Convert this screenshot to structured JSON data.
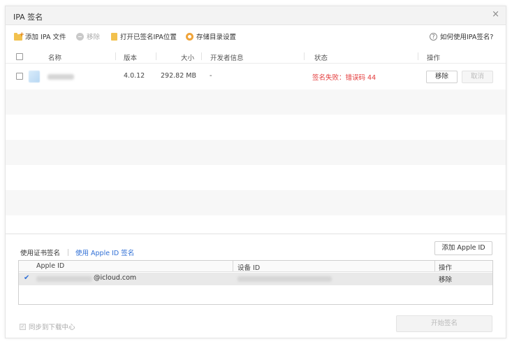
{
  "window": {
    "title": "IPA 签名",
    "close_glyph": "×"
  },
  "toolbar": {
    "add_ipa": "添加 IPA 文件",
    "remove": "移除",
    "open_signed": "打开已签名IPA位置",
    "storage_settings": "存储目录设置",
    "help": "如何使用IPA签名?",
    "help_glyph": "?"
  },
  "table": {
    "headers": {
      "name": "名称",
      "version": "版本",
      "size": "大小",
      "developer": "开发者信息",
      "status": "状态",
      "actions": "操作"
    },
    "rows": [
      {
        "version": "4.0.12",
        "size": "292.82 MB",
        "developer": "-",
        "status": "签名失败：错误码 44",
        "remove": "移除",
        "cancel": "取消"
      }
    ]
  },
  "signing": {
    "tab_cert": "使用证书签名",
    "tab_apple_id": "使用 Apple ID 签名",
    "add_apple_id": "添加 Apple ID",
    "headers": {
      "apple_id": "Apple ID",
      "device_id": "设备 ID",
      "actions": "操作"
    },
    "rows": [
      {
        "check_glyph": "✔",
        "apple_id_suffix": "@icloud.com",
        "action": "移除"
      }
    ]
  },
  "footer": {
    "sync_label": "同步到下载中心",
    "sync_glyph": "✓",
    "start_button": "开始签名"
  },
  "colors": {
    "error": "#e33b3b",
    "link": "#2f6fd6",
    "folder": "#f2c14e",
    "gear": "#f0a43a"
  }
}
